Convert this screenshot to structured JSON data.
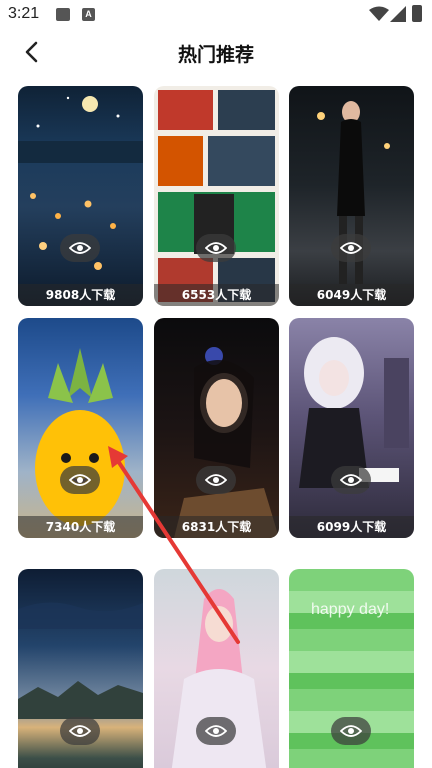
{
  "status": {
    "time": "3:21",
    "a_glyph": "A"
  },
  "header": {
    "title": "热门推荐"
  },
  "cards": [
    {
      "downloads": "9808人下载",
      "thumb": "night-lake-lanterns"
    },
    {
      "downloads": "6553人下载",
      "thumb": "anime-swordsman-collage"
    },
    {
      "downloads": "6049人下载",
      "thumb": "woman-night-street"
    },
    {
      "downloads": "7340人下载",
      "thumb": "cute-pineapple-character"
    },
    {
      "downloads": "6831人下载",
      "thumb": "woman-portrait-dark"
    },
    {
      "downloads": "6099人下载",
      "thumb": "gothic-anime-girl"
    },
    {
      "downloads": "",
      "thumb": "night-sky-lake"
    },
    {
      "downloads": "",
      "thumb": "pink-haired-princess"
    },
    {
      "downloads": "",
      "thumb": "green-stripes",
      "text": "happy day!"
    }
  ],
  "colors": {
    "annotation_arrow": "#e53935"
  }
}
